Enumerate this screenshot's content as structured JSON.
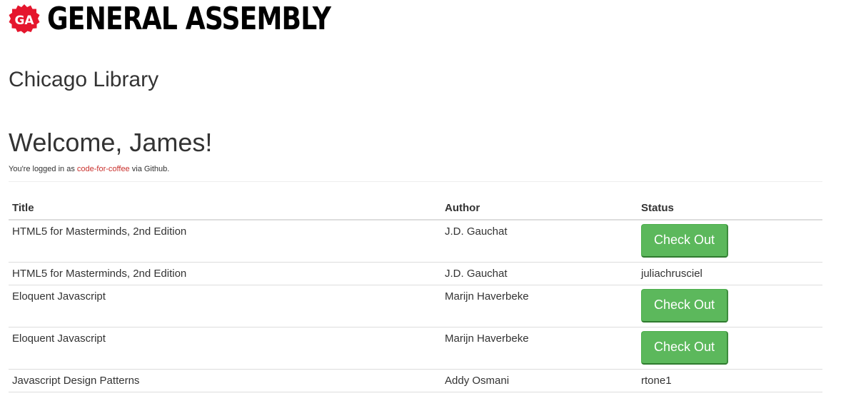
{
  "brand": {
    "badge_text": "GA",
    "name": "GENERAL ASSEMBLY",
    "color": "#e5162d"
  },
  "library_title": "Chicago Library",
  "welcome": "Welcome, James!",
  "login_note": {
    "prefix": "You're logged in as ",
    "username": "code-for-coffee",
    "suffix": " via Github."
  },
  "table": {
    "headers": {
      "title": "Title",
      "author": "Author",
      "status": "Status"
    },
    "rows": [
      {
        "title": "HTML5 for Masterminds, 2nd Edition",
        "author": "J.D. Gauchat",
        "status": "Check Out",
        "status_type": "button"
      },
      {
        "title": "HTML5 for Masterminds, 2nd Edition",
        "author": "J.D. Gauchat",
        "status": "juliachrusciel",
        "status_type": "text"
      },
      {
        "title": "Eloquent Javascript",
        "author": "Marijn Haverbeke",
        "status": "Check Out",
        "status_type": "button"
      },
      {
        "title": "Eloquent Javascript",
        "author": "Marijn Haverbeke",
        "status": "Check Out",
        "status_type": "button"
      },
      {
        "title": "Javascript Design Patterns",
        "author": "Addy Osmani",
        "status": "rtone1",
        "status_type": "text"
      }
    ]
  },
  "colors": {
    "button_green": "#5cb85c",
    "link_red": "#c9302c"
  }
}
